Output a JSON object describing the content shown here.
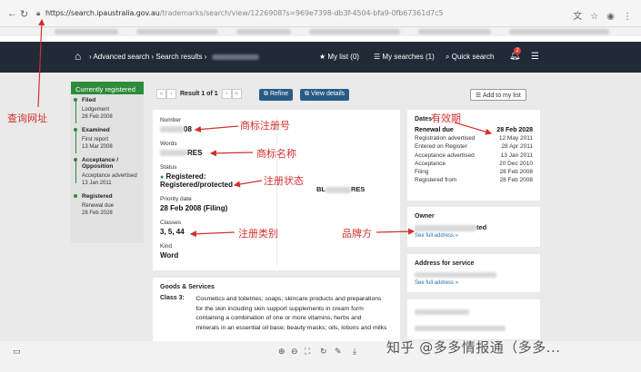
{
  "browser": {
    "url_host": "https://search.ipaustralia.gov.au",
    "url_path": "/trademarks/search/view/1226908?s=969e7398-db3f-4504-bfa9-0fb67361d7c5",
    "icons": [
      "translate-icon",
      "star-icon",
      "account-icon",
      "more-icon"
    ]
  },
  "nav": {
    "advanced_search": "Advanced search",
    "search_results": "Search results",
    "my_list": "My list (0)",
    "my_searches": "My searches (1)",
    "quick_search": "Quick search",
    "notification_count": "2"
  },
  "sidebar": {
    "status": "Currently registered",
    "steps": [
      {
        "title": "Filed",
        "events": [
          {
            "label": "Lodgement",
            "date": "28 Feb 2008"
          }
        ]
      },
      {
        "title": "Examined",
        "events": [
          {
            "label": "First report",
            "date": "13 Mar 2008"
          }
        ]
      },
      {
        "title": "Acceptance / Opposition",
        "events": [
          {
            "label": "Acceptance advertised",
            "date": "13 Jan 2011"
          }
        ]
      },
      {
        "title": "Registered",
        "events": [
          {
            "label": "Renewal due",
            "date": "28 Feb 2028"
          }
        ]
      }
    ]
  },
  "toolbar": {
    "result": "Result 1 of 1",
    "refine": "Refine",
    "view_details": "View details",
    "add_to_list": "Add to my list"
  },
  "details": {
    "number_label": "Number",
    "number_value": "08",
    "words_label": "Words",
    "words_value": "RES",
    "status_label": "Status",
    "status_value_1": "Registered:",
    "status_value_2": "Registered/protected",
    "priority_label": "Priority date",
    "priority_value": "28 Feb 2008 (Filing)",
    "classes_label": "Classes",
    "classes_value": "3, 5, 44",
    "kind_label": "Kind",
    "kind_value": "Word",
    "mark_image_text_start": "BL",
    "mark_image_text_end": "RES"
  },
  "dates": {
    "title": "Dates",
    "rows": [
      {
        "label": "Renewal due",
        "value": "28 Feb 2028"
      },
      {
        "label": "Registration advertised",
        "value": "12 May 2011"
      },
      {
        "label": "Entered on Register",
        "value": "28 Apr 2011"
      },
      {
        "label": "Acceptance advertised",
        "value": "13 Jan 2011"
      },
      {
        "label": "Acceptance",
        "value": "20 Dec 2010"
      },
      {
        "label": "Filing",
        "value": "28 Feb 2008"
      },
      {
        "label": "Registered from",
        "value": "28 Feb 2008"
      }
    ]
  },
  "owner": {
    "title": "Owner",
    "name_end": "ted",
    "see_full": "See full address »"
  },
  "service": {
    "title": "Address for service",
    "see_full": "See full address »"
  },
  "goods": {
    "title": "Goods & Services",
    "class_label": "Class 3:",
    "lines": [
      "Cosmetics and toiletries; soaps; skincare products and preparations",
      "for the skin including skin support supplements in cream form",
      "containing a combination of one or more vitamins, herbs and",
      "minerals in an essential oil base; beauty masks; oils, lotions and milks"
    ]
  },
  "annotations": {
    "url": "查询网址",
    "number": "商标注册号",
    "words": "商标名称",
    "status": "注册状态",
    "classes": "注册类别",
    "owner": "品牌方",
    "validity": "有效期"
  },
  "watermark": "知乎 @多多情报通（多多..."
}
